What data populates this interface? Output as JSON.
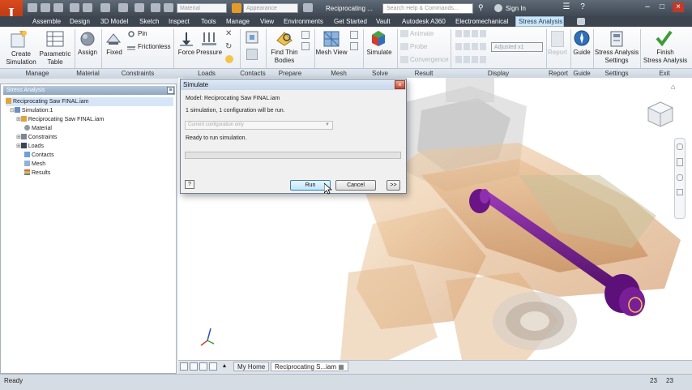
{
  "app": {
    "title": "Reciprocating ...",
    "logo_letter": "I"
  },
  "titlebar": {
    "material_combo": "Material",
    "appearance_combo": "Appearance",
    "search_placeholder": "Search Help & Commands...",
    "sign_in": "Sign In"
  },
  "ribbon_tabs": [
    "Assemble",
    "Design",
    "3D Model",
    "Sketch",
    "Inspect",
    "Tools",
    "Manage",
    "View",
    "Environments",
    "Get Started",
    "Vault",
    "Autodesk A360",
    "Electromechanical",
    "Stress Analysis"
  ],
  "ribbon": {
    "create_simulation": "Create\nSimulation",
    "parametric_table": "Parametric\nTable",
    "assign": "Assign",
    "fixed": "Fixed",
    "pin": "Pin",
    "frictionless": "Frictionless",
    "force": "Force",
    "pressure": "Pressure",
    "find_thin_bodies": "Find Thin\nBodies",
    "mesh_view": "Mesh View",
    "simulate": "Simulate",
    "animate": "Animate",
    "probe": "Probe",
    "convergence": "Convergence",
    "adjusted": "Adjusted x1",
    "report": "Report",
    "guide": "Guide",
    "stress_analysis_settings": "Stress Analysis\nSettings",
    "finish_stress_analysis": "Finish\nStress Analysis"
  },
  "panels": [
    "Manage",
    "Material",
    "Constraints",
    "Loads",
    "Contacts",
    "Prepare",
    "Mesh",
    "Solve",
    "Display",
    "Result",
    "Report",
    "Guide",
    "Settings",
    "Exit"
  ],
  "browser": {
    "header": "Stress Analysis",
    "root": "Reciprocating Saw FINAL.iam",
    "items": [
      "Simulation:1",
      "Reciprocating Saw FINAL.iam",
      "Material",
      "Constraints",
      "Loads",
      "Contacts",
      "Mesh",
      "Results"
    ]
  },
  "dialog": {
    "title": "Simulate",
    "close": "×",
    "model_line": "Model: Reciprocating Saw FINAL.iam",
    "summary_line": "1 simulation, 1 configuration will be run.",
    "select_value": "Current configuration only",
    "status_line": "Ready to run simulation.",
    "run_label": "Run",
    "cancel_label": "Cancel",
    "more_label": ">>",
    "help_label": "?"
  },
  "doc_tabs": [
    "My Home",
    "Reciprocating S...iam"
  ],
  "status": {
    "text": "Ready",
    "num1": "23",
    "num2": "23"
  },
  "colors": {
    "accent": "#cde4f5",
    "model_orange": "#d9a66e",
    "rod_purple": "#6b1486",
    "logo_red": "#c93a14"
  }
}
